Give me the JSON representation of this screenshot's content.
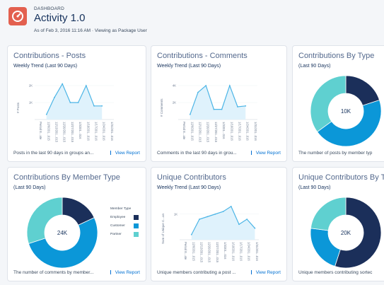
{
  "header": {
    "kicker": "DASHBOARD",
    "title": "Activity 1.0",
    "subtitle": "As of Feb 3, 2016 11:16 AM · Viewing as Package User"
  },
  "cards": {
    "posts": {
      "title": "Contributions - Posts",
      "subtitle": "Weekly Trend (Last 90 Days)",
      "footer": "Posts in the last 90 days in groups an...",
      "link": "View Report",
      "ylabel": "# Posts"
    },
    "comments": {
      "title": "Contributions - Comments",
      "subtitle": "Weekly Trend (Last 90 Days)",
      "footer": "Comments in the last 90 days in grou...",
      "link": "View Report",
      "ylabel": "# Comments"
    },
    "by_type": {
      "title": "Contributions By Type",
      "subtitle": "(Last 90 Days)",
      "footer": "The number of posts by member typ",
      "center": "10K"
    },
    "by_member": {
      "title": "Contributions By Member Type",
      "subtitle": "(Last 90 Days)",
      "footer": "The number of comments by member...",
      "link": "View Report",
      "center": "24K",
      "legend_title": "Member Type",
      "legend": [
        "Employee",
        "Customer",
        "Partner"
      ]
    },
    "unique": {
      "title": "Unique Contributors",
      "subtitle": "Weekly Trend (Last 90 Days)",
      "footer": "Unique members contributing a post ...",
      "link": "View Report",
      "ylabel": "Sum of Unique C...un"
    },
    "unique_by": {
      "title": "Unique Contributors By T",
      "subtitle": "(Last 90 Days)",
      "footer": "Unique members contributing sortec",
      "center": "20K"
    }
  },
  "colors": {
    "dark": "#1b2f5a",
    "mid": "#0b97d8",
    "light": "#5fd0d0",
    "line": "#4cb5e6",
    "area": "#dff2fc"
  },
  "chart_data": [
    {
      "type": "area",
      "title": "Contributions - Posts",
      "ylabel": "# Posts",
      "x": [
        "Period E...ate",
        "12/6/201...015",
        "12/13/201...015",
        "12/20/201...015",
        "12/27/201...015",
        "1/3/201...016",
        "1/10/201...016",
        "1/17/201...016",
        "1/24/201...016",
        "1/31/201...016"
      ],
      "y_ticks": [
        "2K",
        "1K"
      ],
      "y_range": [
        0,
        2.5
      ],
      "values": [
        0.3,
        1.3,
        2.1,
        1.0,
        1.0,
        2.0,
        0.8,
        0.8
      ]
    },
    {
      "type": "area",
      "title": "Contributions - Comments",
      "ylabel": "# Comments",
      "x": [
        "Period E...ate",
        "12/6/201...015",
        "12/13/201...015",
        "12/20/201...015",
        "12/27/201...015",
        "1/3/201...016",
        "1/10/201...016",
        "1/17/201...016",
        "1/24/201...016",
        "1/31/201...016"
      ],
      "y_ticks": [
        "4K",
        "2K"
      ],
      "y_range": [
        0,
        5
      ],
      "values": [
        0.6,
        3.2,
        4.0,
        1.2,
        1.2,
        4.0,
        1.5,
        1.6
      ]
    },
    {
      "type": "pie",
      "title": "Contributions By Type",
      "center": "10K",
      "values": [
        20,
        45,
        35
      ]
    },
    {
      "type": "pie",
      "title": "Contributions By Member Type",
      "center": "24K",
      "categories": [
        "Employee",
        "Customer",
        "Partner"
      ],
      "values": [
        18,
        52,
        30
      ]
    },
    {
      "type": "area",
      "title": "Unique Contributors",
      "ylabel": "Sum of Unique C...un",
      "x": [
        "Period E...ate",
        "12/6/201...015",
        "12/13/201...015",
        "12/20/201...015",
        "12/27/201...015",
        "1/3/201...016",
        "1/10/201...016",
        "1/17/201...016",
        "1/24/201...016",
        "1/31/201...016"
      ],
      "y_ticks": [
        "1K"
      ],
      "y_range": [
        0,
        1.6
      ],
      "values": [
        0.2,
        0.8,
        0.9,
        1.0,
        1.1,
        1.3,
        0.6,
        0.8,
        0.45
      ]
    },
    {
      "type": "pie",
      "title": "Unique Contributors By T",
      "center": "20K",
      "values": [
        55,
        22,
        23
      ]
    }
  ]
}
